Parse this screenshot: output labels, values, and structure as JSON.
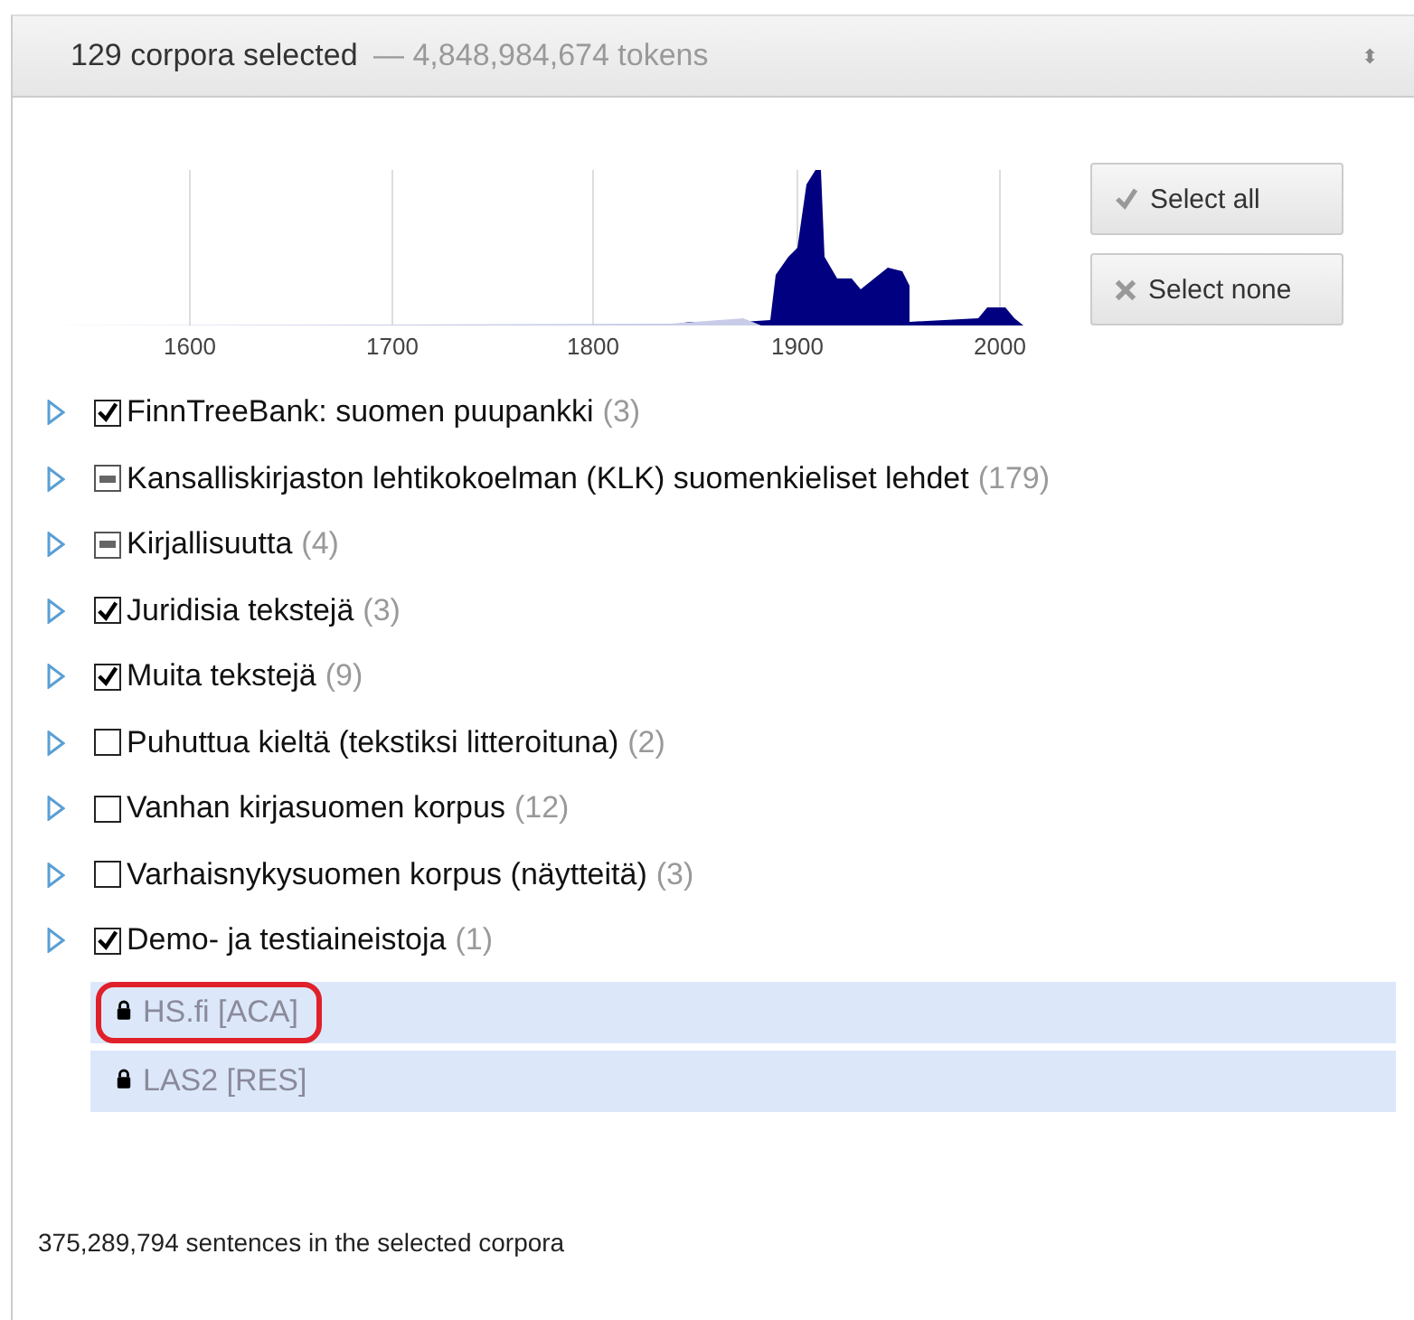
{
  "header": {
    "selected_count": "129 corpora selected",
    "tokens": "— 4,848,984,674 tokens",
    "toggle_icon": "⬍"
  },
  "timeline": {
    "year_labels": [
      "1600",
      "1700",
      "1800",
      "1900",
      "2000"
    ]
  },
  "buttons": [
    {
      "kind": "check",
      "label": "Select all"
    },
    {
      "kind": "cross",
      "label": "Select none"
    }
  ],
  "tree": [
    {
      "label": "FinnTreeBank: suomen puupankki",
      "count": "(3)",
      "checked": true,
      "partial": false,
      "expanded": false
    },
    {
      "label": "Kansalliskirjaston lehtikokoelman (KLK) suomenkieliset lehdet",
      "count": "(179)",
      "checked": false,
      "partial": true,
      "expanded": false
    },
    {
      "label": "Kirjallisuutta",
      "count": "(4)",
      "checked": false,
      "partial": true,
      "expanded": false
    },
    {
      "label": "Juridisia tekstejä",
      "count": "(3)",
      "checked": true,
      "partial": false,
      "expanded": false
    },
    {
      "label": "Muita tekstejä",
      "count": "(9)",
      "checked": true,
      "partial": false,
      "expanded": false
    },
    {
      "label": "Puhuttua kieltä (tekstiksi litteroituna)",
      "count": "(2)",
      "checked": false,
      "partial": false,
      "expanded": false
    },
    {
      "label": "Vanhan kirjasuomen korpus",
      "count": "(12)",
      "checked": false,
      "partial": false,
      "expanded": false
    },
    {
      "label": "Varhaisnykysuomen korpus (näytteitä)",
      "count": "(3)",
      "checked": false,
      "partial": false,
      "expanded": false
    },
    {
      "label": "Demo- ja testiaineistoja",
      "count": "(1)",
      "checked": true,
      "partial": false,
      "expanded": false
    }
  ],
  "locked": [
    {
      "label": "HS.fi [ACA]",
      "highlighted": true
    },
    {
      "label": "LAS2 [RES]",
      "highlighted": false
    }
  ],
  "footer": "375,289,794 sentences in the selected corpora"
}
